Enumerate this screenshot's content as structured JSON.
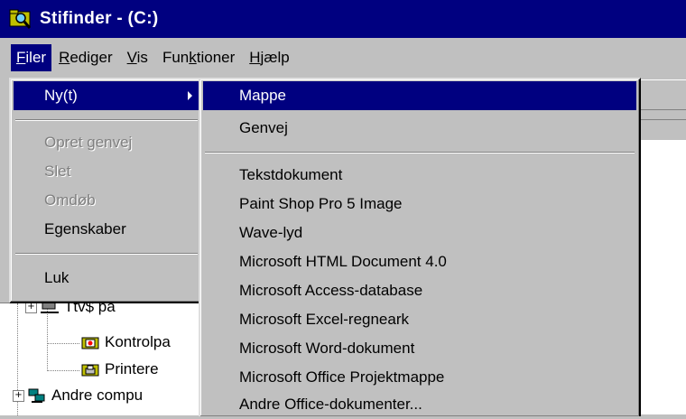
{
  "window": {
    "title": "Stifinder -  (C:)"
  },
  "menubar": {
    "items": [
      {
        "label": "Filer",
        "access_key": "F"
      },
      {
        "label": "Rediger",
        "access_key": "R"
      },
      {
        "label": "Vis",
        "access_key": "V"
      },
      {
        "label": "Funktioner",
        "access_key": "k"
      },
      {
        "label": "Hjælp",
        "access_key": "H"
      }
    ]
  },
  "file_menu": {
    "items": [
      {
        "label": "Ny(t)",
        "state": "highlighted",
        "has_submenu": true
      },
      {
        "label": "Opret genvej",
        "state": "disabled"
      },
      {
        "label": "Slet",
        "state": "disabled"
      },
      {
        "label": "Omdøb",
        "state": "disabled"
      },
      {
        "label": "Egenskaber",
        "state": "enabled"
      },
      {
        "label": "Luk",
        "state": "enabled"
      }
    ]
  },
  "new_submenu": {
    "items": [
      {
        "label": "Mappe",
        "state": "highlighted"
      },
      {
        "label": "Genvej"
      },
      {
        "label": "Tekstdokument"
      },
      {
        "label": "Paint Shop Pro 5 Image"
      },
      {
        "label": "Wave-lyd"
      },
      {
        "label": "Microsoft HTML Document 4.0"
      },
      {
        "label": "Microsoft Access-database"
      },
      {
        "label": "Microsoft Excel-regneark"
      },
      {
        "label": "Microsoft Word-dokument"
      },
      {
        "label": "Microsoft Office Projektmappe"
      },
      {
        "label": "Andre Office-dokumenter..."
      }
    ]
  },
  "tree": {
    "items": [
      {
        "label": "Ttv$ på"
      },
      {
        "label": "Kontrolpa"
      },
      {
        "label": "Printere"
      },
      {
        "label": "Andre compu"
      }
    ]
  },
  "colors": {
    "titlebar": "#000080",
    "menu_bg": "#c0c0c0",
    "highlight": "#000080"
  }
}
